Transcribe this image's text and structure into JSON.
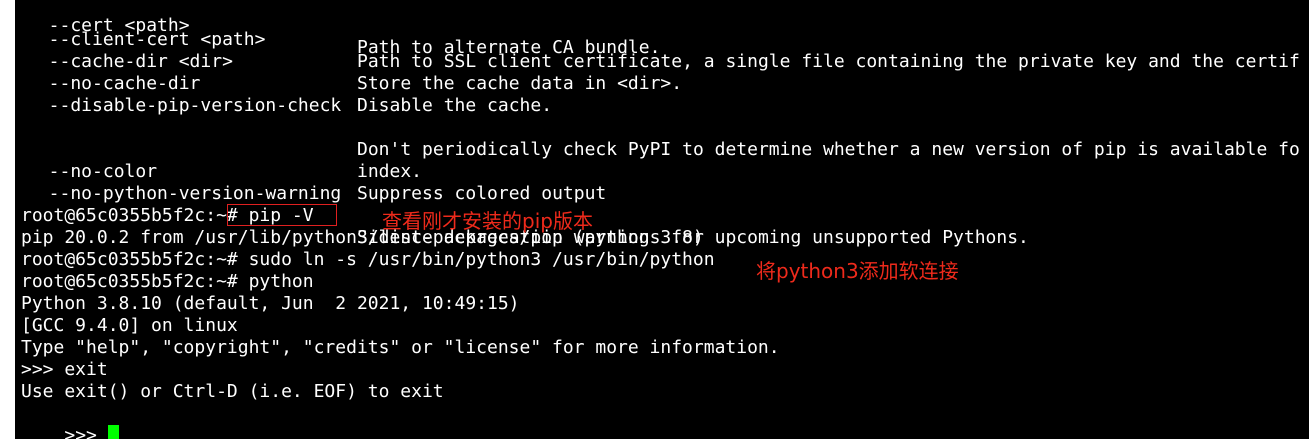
{
  "terminal": {
    "lines": [
      {
        "opt": "  --cert <path>",
        "desc": "Path to alternate CA bundle."
      },
      {
        "opt": "  --client-cert <path>",
        "desc": "Path to SSL client certificate, a single file containing the private key and the certif"
      },
      {
        "opt": "  --cache-dir <dir>",
        "desc": "Store the cache data in <dir>."
      },
      {
        "opt": "  --no-cache-dir",
        "desc": "Disable the cache."
      },
      {
        "opt": "  --disable-pip-version-check",
        "desc": ""
      },
      {
        "opt": "",
        "desc": "Don't periodically check PyPI to determine whether a new version of pip is available fo"
      },
      {
        "opt": "",
        "desc": "index."
      },
      {
        "opt": "  --no-color",
        "desc": "Suppress colored output"
      },
      {
        "opt": "  --no-python-version-warning",
        "desc": ""
      },
      {
        "opt": "",
        "desc": "Silence deprecation warnings for upcoming unsupported Pythons."
      }
    ],
    "session": [
      "root@65c0355b5f2c:~# pip -V",
      "pip 20.0.2 from /usr/lib/python3/dist-packages/pip (python 3.8)",
      "root@65c0355b5f2c:~# sudo ln -s /usr/bin/python3 /usr/bin/python",
      "root@65c0355b5f2c:~# python",
      "Python 3.8.10 (default, Jun  2 2021, 10:49:15)",
      "[GCC 9.4.0] on linux",
      "Type \"help\", \"copyright\", \"credits\" or \"license\" for more information.",
      ">>> exit",
      "Use exit() or Ctrl-D (i.e. EOF) to exit"
    ],
    "prompt": ">>> "
  },
  "annotations": {
    "pip_version": "查看刚才安装的pip版本",
    "symlink": "将python3添加软连接"
  },
  "colors": {
    "background": "#000000",
    "text": "#ffffff",
    "cursor": "#00ff00",
    "annotation": "#ee2a1b"
  }
}
